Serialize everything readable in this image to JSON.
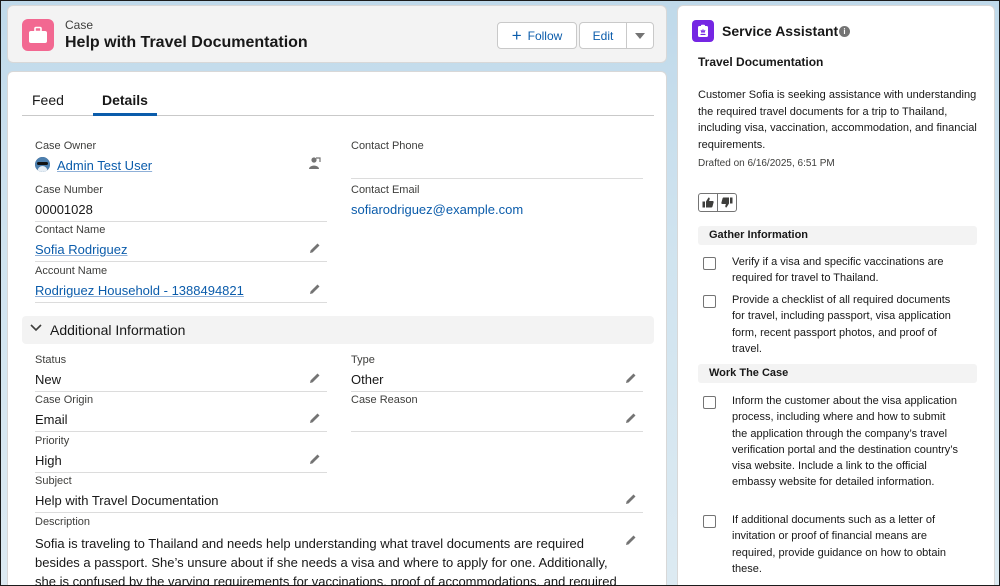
{
  "record": {
    "object_label": "Case",
    "title": "Help with Travel Documentation",
    "follow_label": "Follow",
    "edit_label": "Edit"
  },
  "tabs": [
    {
      "label": "Feed",
      "active": false
    },
    {
      "label": "Details",
      "active": true
    }
  ],
  "details": {
    "case_owner": {
      "label": "Case Owner",
      "value": "Admin Test User"
    },
    "contact_phone": {
      "label": "Contact Phone",
      "value": ""
    },
    "case_number": {
      "label": "Case Number",
      "value": "00001028"
    },
    "contact_email": {
      "label": "Contact Email",
      "value": "sofiarodriguez@example.com"
    },
    "contact_name": {
      "label": "Contact Name",
      "value": "Sofia Rodriguez"
    },
    "account_name": {
      "label": "Account Name",
      "value": "Rodriguez Household - 1388494821"
    }
  },
  "additional": {
    "section_title": "Additional Information",
    "status": {
      "label": "Status",
      "value": "New"
    },
    "type": {
      "label": "Type",
      "value": "Other"
    },
    "case_origin": {
      "label": "Case Origin",
      "value": "Email"
    },
    "case_reason": {
      "label": "Case Reason",
      "value": ""
    },
    "priority": {
      "label": "Priority",
      "value": "High"
    },
    "subject": {
      "label": "Subject",
      "value": "Help with Travel Documentation"
    },
    "description": {
      "label": "Description",
      "value": "Sofia is traveling to Thailand and needs help understanding what travel documents are required besides a passport. She’s unsure about if she needs a visa and where to apply for one. Additionally, she is confused by the varying requirements for vaccinations, proof of accommodations, and required financial funds."
    }
  },
  "assistant": {
    "title": "Service Assistant",
    "info_glyph": "i",
    "subtitle": "Travel Documentation",
    "summary": "Customer Sofia is seeking assistance with understanding the required travel documents for a trip to Thailand, including visa, vaccination, accommodation, and financial requirements.",
    "drafted": "Drafted on 6/16/2025, 6:51 PM",
    "groups": [
      {
        "title": "Gather Information",
        "tasks": [
          "Verify if a visa and specific vaccinations are required for travel to Thailand.",
          "Provide a checklist of all required documents for travel, including passport, visa application form, recent passport photos, and proof of travel."
        ]
      },
      {
        "title": "Work The Case",
        "tasks": [
          "Inform the customer about the visa application process, including where and how to submit the application through the company’s travel verification portal and the destination country’s visa website. Include a link to the official embassy website for detailed information.",
          "If additional documents such as a letter of invitation or proof of financial means are required, provide guidance on how to obtain these."
        ]
      }
    ]
  },
  "colors": {
    "brand_blue": "#0b5cab",
    "case_icon": "#f26891",
    "assistant_icon": "#7526e3"
  },
  "icons": [
    "briefcase-icon",
    "plus-icon",
    "chevron-down-icon",
    "avatar",
    "change-owner-icon",
    "pencil-icon",
    "assistant-icon",
    "info-icon",
    "thumbs-up-icon",
    "thumbs-down-icon",
    "checkbox"
  ]
}
